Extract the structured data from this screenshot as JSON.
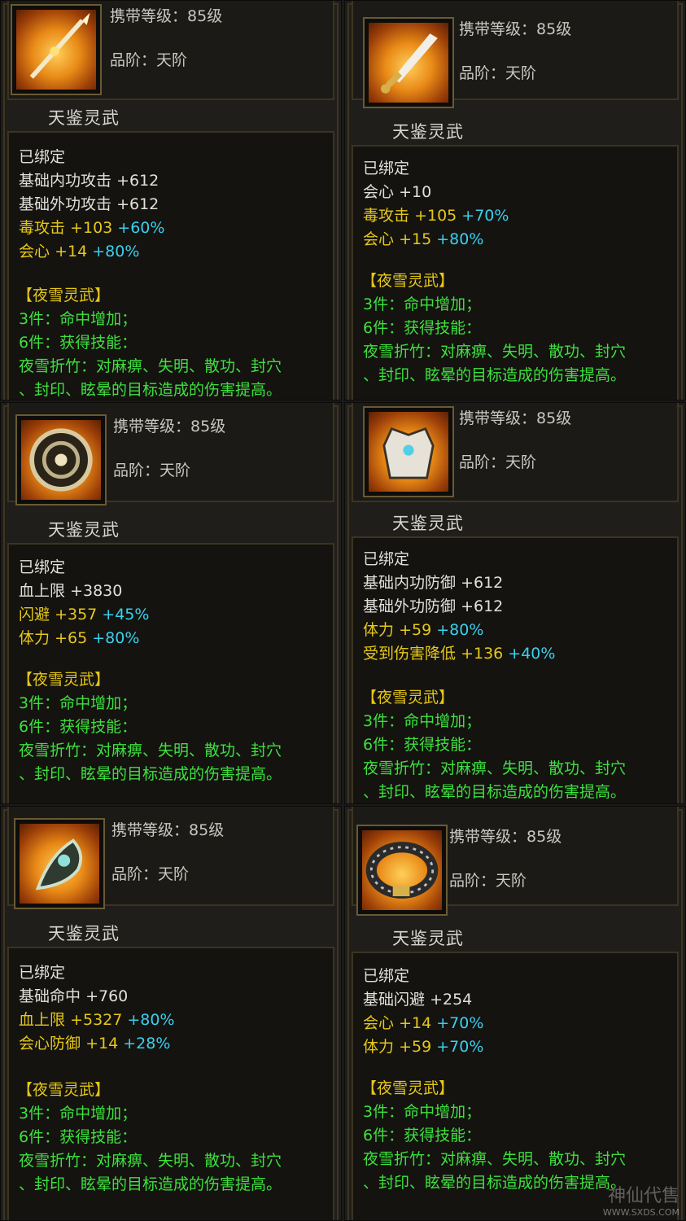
{
  "labels": {
    "level_label": "携带等级：",
    "tier_label": "品阶：",
    "bound": "已绑定",
    "set_name": "【夜雪灵武】",
    "set_3": "3件：命中增加；",
    "set_6": "6件：获得技能：",
    "skill_1": "夜雪折竹：对麻痹、失明、散功、封穴",
    "skill_2": "、封印、眩晕的目标造成的伤害提高。"
  },
  "items": [
    {
      "icon": "spear-icon",
      "level": "85级",
      "tier": "天阶",
      "name": "天鉴灵武",
      "stats": [
        {
          "name": "基础内功攻击",
          "value": "+612",
          "pct": "",
          "color": "white"
        },
        {
          "name": "基础外功攻击",
          "value": "+612",
          "pct": "",
          "color": "white"
        },
        {
          "name": "毒攻击",
          "value": "+103",
          "pct": "+60%",
          "color": "yellow"
        },
        {
          "name": "会心",
          "value": "+14",
          "pct": "+80%",
          "color": "yellow"
        }
      ]
    },
    {
      "icon": "dagger-icon",
      "level": "85级",
      "tier": "天阶",
      "name": "天鉴灵武",
      "stats": [
        {
          "name": "会心",
          "value": "+10",
          "pct": "",
          "color": "white"
        },
        {
          "name": "毒攻击",
          "value": "+105",
          "pct": "+70%",
          "color": "yellow"
        },
        {
          "name": "会心",
          "value": "+15",
          "pct": "+80%",
          "color": "yellow"
        }
      ]
    },
    {
      "icon": "shield-icon",
      "level": "85级",
      "tier": "天阶",
      "name": "天鉴灵武",
      "stats": [
        {
          "name": "血上限",
          "value": "+3830",
          "pct": "",
          "color": "white"
        },
        {
          "name": "闪避",
          "value": "+357",
          "pct": "+45%",
          "color": "yellow"
        },
        {
          "name": "体力",
          "value": "+65",
          "pct": "+80%",
          "color": "yellow"
        }
      ]
    },
    {
      "icon": "armor-icon",
      "level": "85级",
      "tier": "天阶",
      "name": "天鉴灵武",
      "stats": [
        {
          "name": "基础内功防御",
          "value": "+612",
          "pct": "",
          "color": "white"
        },
        {
          "name": "基础外功防御",
          "value": "+612",
          "pct": "",
          "color": "white"
        },
        {
          "name": "体力",
          "value": "+59",
          "pct": "+80%",
          "color": "yellow"
        },
        {
          "name": "受到伤害降低",
          "value": "+136",
          "pct": "+40%",
          "color": "yellow"
        }
      ]
    },
    {
      "icon": "amulet-icon",
      "level": "85级",
      "tier": "天阶",
      "name": "天鉴灵武",
      "stats": [
        {
          "name": "基础命中",
          "value": "+760",
          "pct": "",
          "color": "white"
        },
        {
          "name": "血上限",
          "value": "+5327",
          "pct": "+80%",
          "color": "yellow"
        },
        {
          "name": "会心防御",
          "value": "+14",
          "pct": "+28%",
          "color": "yellow"
        }
      ]
    },
    {
      "icon": "belt-icon",
      "level": "85级",
      "tier": "天阶",
      "name": "天鉴灵武",
      "stats": [
        {
          "name": "基础闪避",
          "value": "+254",
          "pct": "",
          "color": "white"
        },
        {
          "name": "会心",
          "value": "+14",
          "pct": "+70%",
          "color": "yellow"
        },
        {
          "name": "体力",
          "value": "+59",
          "pct": "+70%",
          "color": "yellow"
        }
      ]
    }
  ],
  "watermark": {
    "brand": "神仙代售",
    "url": "WWW.SXDS.COM"
  }
}
